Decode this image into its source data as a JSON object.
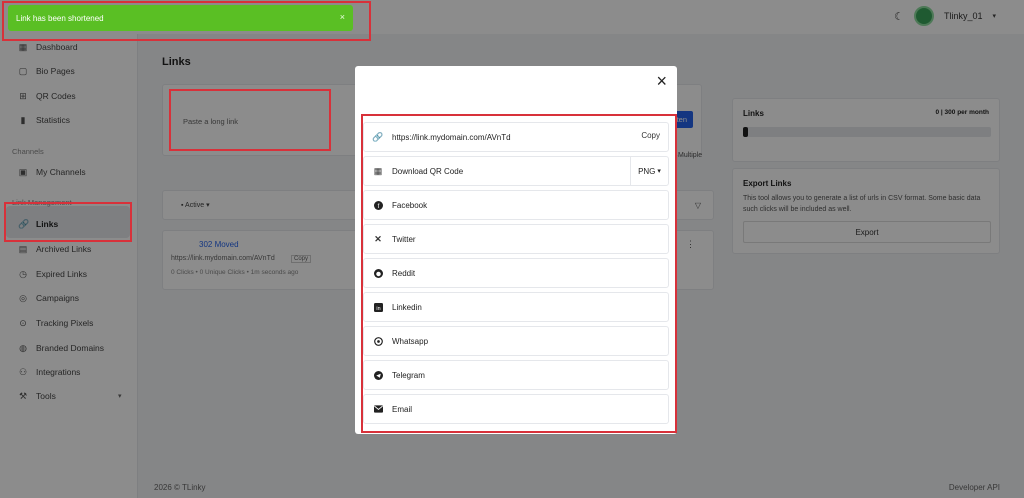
{
  "toast": {
    "message": "Link has been shortened",
    "close": "×"
  },
  "topbar": {
    "username": "Tlinky_01",
    "theme_icon": "moon-icon"
  },
  "sidebar": {
    "items": [
      {
        "label": "Dashboard",
        "icon": "grid-icon"
      },
      {
        "label": "Bio Pages",
        "icon": "page-icon"
      },
      {
        "label": "QR Codes",
        "icon": "qr-icon"
      },
      {
        "label": "Statistics",
        "icon": "chart-icon"
      }
    ],
    "section_channels": "Channels",
    "channels_item": "My Channels",
    "section_links": "Link Management",
    "links_items": [
      {
        "label": "Links",
        "icon": "link-icon"
      },
      {
        "label": "Archived Links",
        "icon": "archive-icon"
      },
      {
        "label": "Expired Links",
        "icon": "clock-icon"
      },
      {
        "label": "Campaigns",
        "icon": "campaign-icon"
      },
      {
        "label": "Tracking Pixels",
        "icon": "pixel-icon"
      },
      {
        "label": "Branded Domains",
        "icon": "globe-icon"
      },
      {
        "label": "Integrations",
        "icon": "plug-icon"
      },
      {
        "label": "Tools",
        "icon": "tools-icon"
      }
    ]
  },
  "main": {
    "title": "Links",
    "paste_placeholder": "Paste a long link",
    "shorten_btn": "...ten",
    "multiple": "Multiple",
    "filter_active": "Active",
    "link_row": {
      "title": "302 Moved",
      "url": "https://link.mydomain.com/AVnTd",
      "copy": "Copy",
      "stats": "0 Clicks • 0 Unique Clicks • 1m seconds ago"
    }
  },
  "right": {
    "links_title": "Links",
    "links_count": "0 | 300 per month",
    "progress_fraction": 0.02,
    "export_title": "Export Links",
    "export_desc": "This tool allows you to generate a list of urls in CSV format. Some basic data such clicks will be included as well.",
    "export_btn": "Export"
  },
  "footer": {
    "left": "2026 © TLinky",
    "right": "Developer API"
  },
  "modal": {
    "close": "×",
    "items": [
      {
        "label": "https://link.mydomain.com/AVnTd",
        "icon": "link-icon",
        "action": "Copy"
      },
      {
        "label": "Download QR Code",
        "icon": "qr-icon",
        "select": "PNG"
      },
      {
        "label": "Facebook",
        "icon": "facebook-icon"
      },
      {
        "label": "Twitter",
        "icon": "x-icon"
      },
      {
        "label": "Reddit",
        "icon": "reddit-icon"
      },
      {
        "label": "Linkedin",
        "icon": "linkedin-icon"
      },
      {
        "label": "Whatsapp",
        "icon": "whatsapp-icon"
      },
      {
        "label": "Telegram",
        "icon": "telegram-icon"
      },
      {
        "label": "Email",
        "icon": "email-icon"
      }
    ]
  },
  "colors": {
    "toast_bg": "#5abf24",
    "accent": "#2563eb",
    "highlight_red": "#d8313a"
  }
}
